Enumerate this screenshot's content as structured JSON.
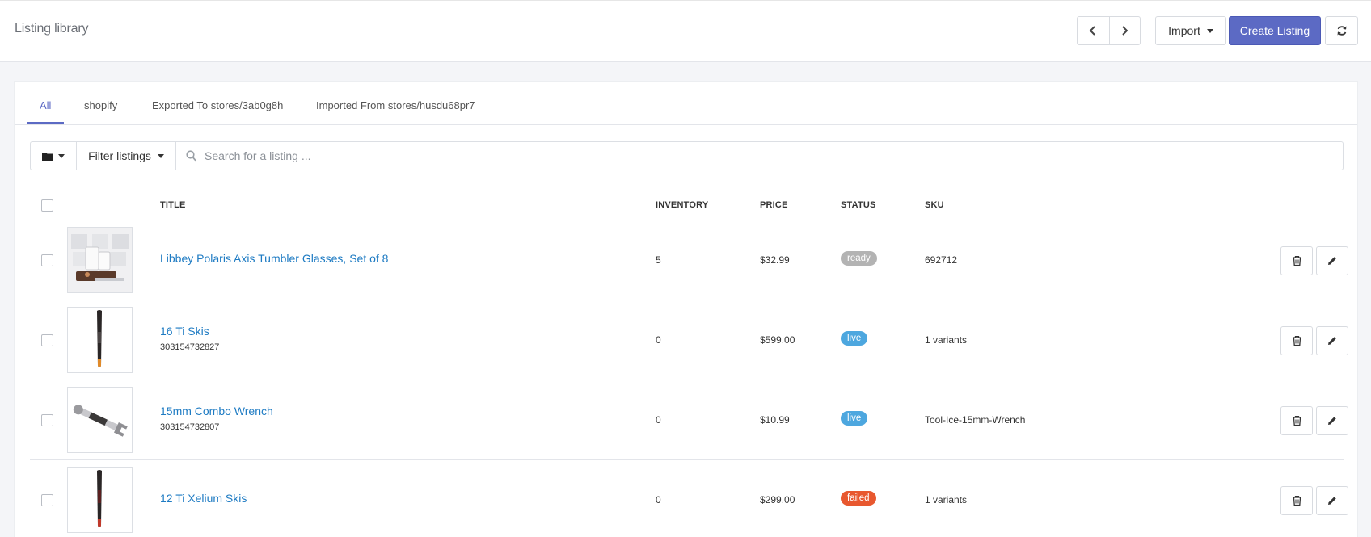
{
  "header": {
    "title": "Listing library",
    "import_label": "Import",
    "create_label": "Create Listing"
  },
  "tabs": [
    {
      "label": "All",
      "active": true
    },
    {
      "label": "shopify"
    },
    {
      "label": "Exported To stores/3ab0g8h"
    },
    {
      "label": "Imported From stores/husdu68pr7"
    }
  ],
  "toolbar": {
    "filter_label": "Filter listings",
    "search_placeholder": "Search for a listing ..."
  },
  "table": {
    "columns": [
      "TITLE",
      "INVENTORY",
      "PRICE",
      "STATUS",
      "SKU"
    ],
    "rows": [
      {
        "title": "Libbey Polaris Axis Tumbler Glasses, Set of 8",
        "id": "",
        "inventory": "5",
        "price": "$32.99",
        "status": "ready",
        "sku": "692712",
        "thumb": "glasses"
      },
      {
        "title": "16 Ti Skis",
        "id": "303154732827",
        "inventory": "0",
        "price": "$599.00",
        "status": "live",
        "sku": "1 variants",
        "thumb": "ski"
      },
      {
        "title": "15mm Combo Wrench",
        "id": "303154732807",
        "inventory": "0",
        "price": "$10.99",
        "status": "live",
        "sku": "Tool-Ice-15mm-Wrench",
        "thumb": "wrench"
      },
      {
        "title": "12 Ti Xelium Skis",
        "id": "",
        "inventory": "0",
        "price": "$299.00",
        "status": "failed",
        "sku": "1 variants",
        "thumb": "ski"
      }
    ]
  },
  "colors": {
    "accent": "#5c6ac4",
    "link": "#1e7bc3",
    "status_ready": "#b3b3b3",
    "status_live": "#4da7df",
    "status_failed": "#e8582f"
  },
  "icons": [
    "chevron-left-icon",
    "chevron-right-icon",
    "refresh-icon",
    "folder-icon",
    "search-icon",
    "trash-icon",
    "pencil-icon"
  ]
}
